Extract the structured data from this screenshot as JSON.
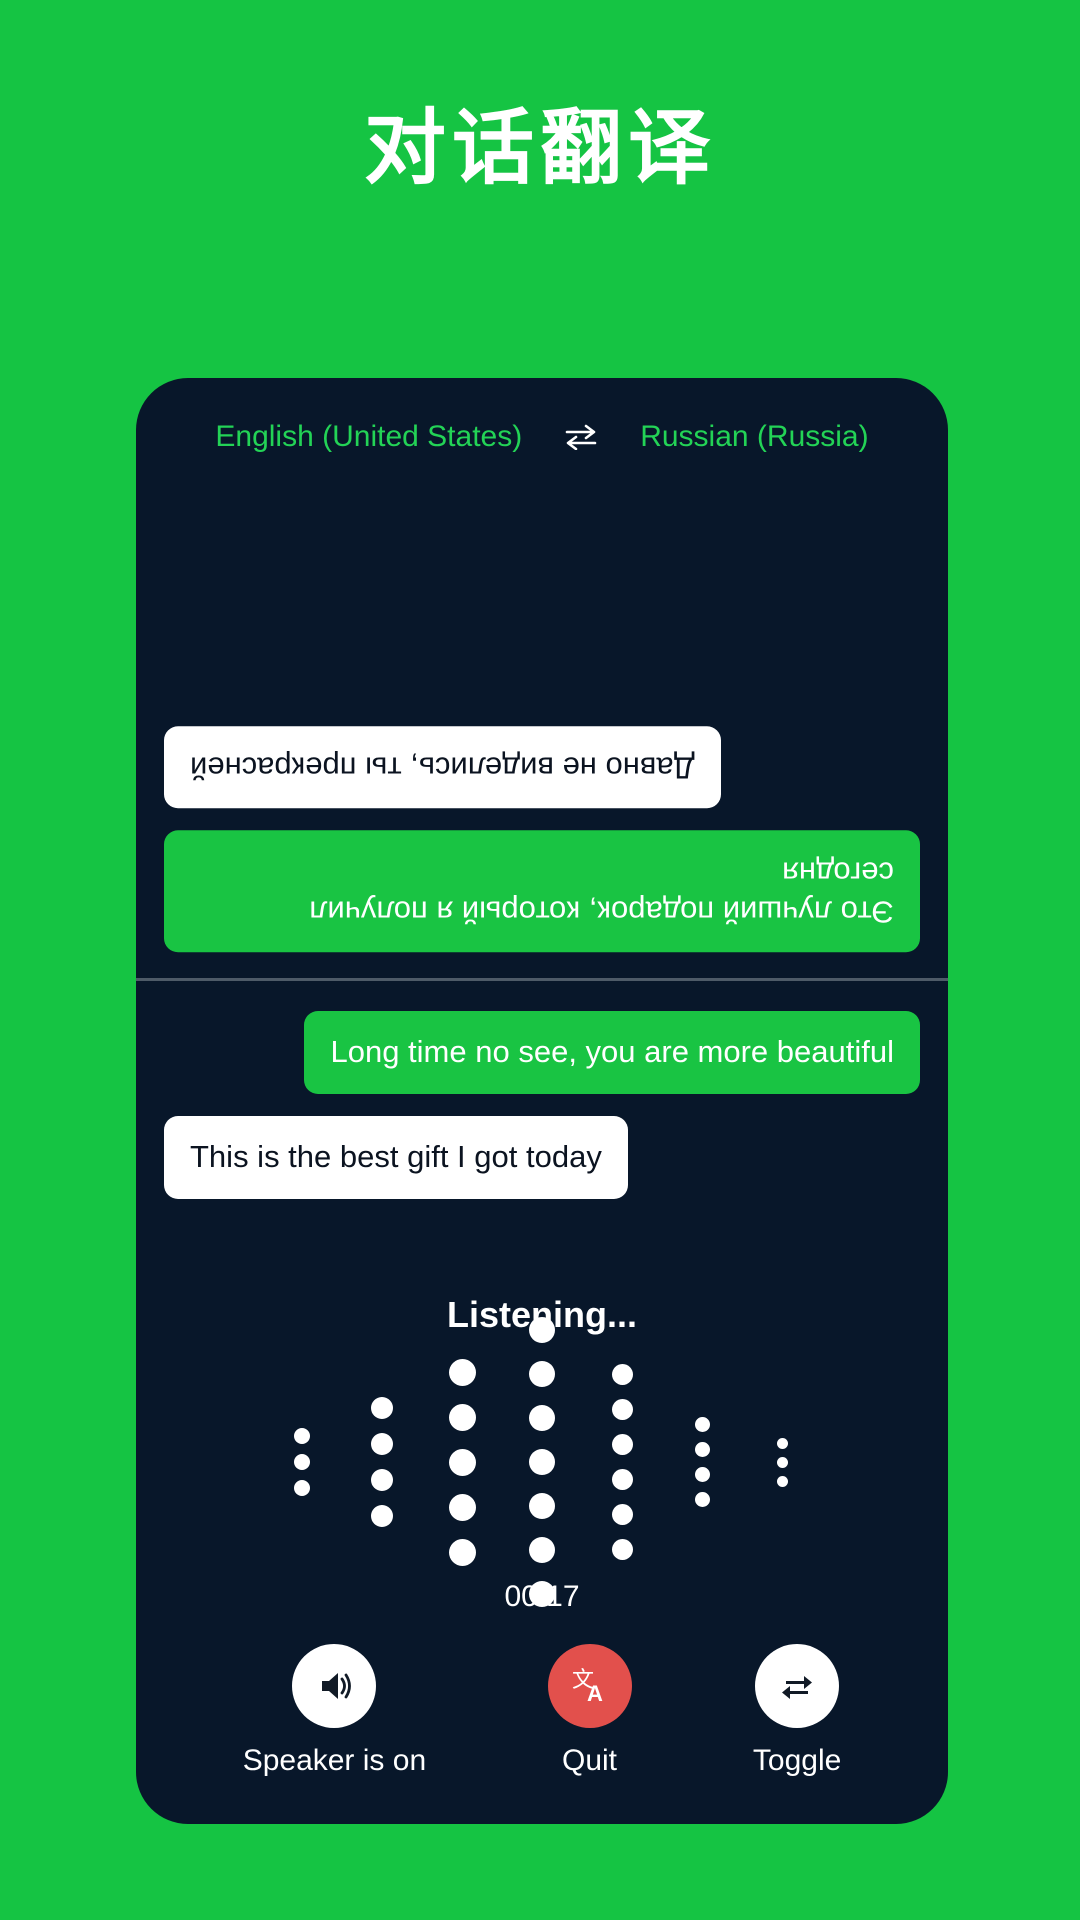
{
  "page": {
    "title": "对话翻译",
    "background_color": "#15c443",
    "card_color": "#08172a",
    "accent_green": "#19c443",
    "quit_red": "#e2504c"
  },
  "language_bar": {
    "source_language": "English (United States)",
    "target_language": "Russian (Russia)",
    "swap_icon": "swap-horizontal-icon",
    "swap_glyph": "⇌"
  },
  "conversation": {
    "remote_pane": {
      "rotated": true,
      "messages": [
        {
          "text": "Это лучший подарок, который я получил сегодня",
          "style": "green",
          "align": "left"
        },
        {
          "text": "Давно не виделись, ты прекрасней",
          "style": "white",
          "align": "right"
        }
      ]
    },
    "local_pane": {
      "rotated": false,
      "messages": [
        {
          "text": "Long time no see, you are more beautiful",
          "style": "green",
          "align": "right"
        },
        {
          "text": "This is the best gift I got today",
          "style": "white",
          "align": "left"
        }
      ]
    }
  },
  "listening": {
    "status_label": "Listening...",
    "timer": "00:17",
    "waveform": {
      "columns": [
        {
          "count": 3,
          "size": 16
        },
        {
          "count": 4,
          "size": 22
        },
        {
          "count": 5,
          "size": 27
        },
        {
          "count": 7,
          "size": 26
        },
        {
          "count": 6,
          "size": 21
        },
        {
          "count": 4,
          "size": 15
        },
        {
          "count": 3,
          "size": 11
        }
      ]
    }
  },
  "controls": [
    {
      "label": "Speaker is on",
      "icon": "speaker-on-icon",
      "style": "white"
    },
    {
      "label": "Quit",
      "icon": "translate-icon",
      "style": "red"
    },
    {
      "label": "Toggle",
      "icon": "swap-repeat-icon",
      "style": "white"
    }
  ]
}
